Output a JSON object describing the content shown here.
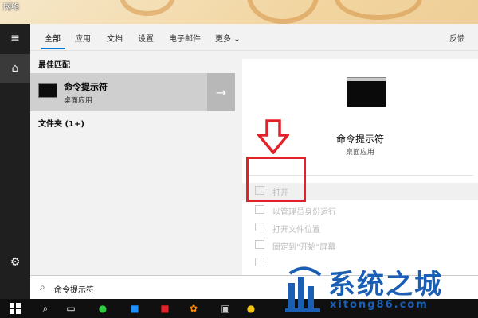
{
  "desktop": {
    "icon_label": "网络"
  },
  "tabs": [
    {
      "label": "全部"
    },
    {
      "label": "应用"
    },
    {
      "label": "文档"
    },
    {
      "label": "设置"
    },
    {
      "label": "电子邮件"
    },
    {
      "label": "更多"
    }
  ],
  "feedback_label": "反馈",
  "left": {
    "best_match_title": "最佳匹配",
    "best_match": {
      "name": "命令提示符",
      "subtitle": "桌面应用"
    },
    "folders_title": "文件夹 (1+)"
  },
  "preview": {
    "name": "命令提示符",
    "subtitle": "桌面应用",
    "actions": [
      {
        "label": "打开",
        "icon": "open-icon"
      },
      {
        "label": "以管理员身份运行",
        "icon": "admin-icon"
      },
      {
        "label": "打开文件位置",
        "icon": "file-location-icon"
      },
      {
        "label": "固定到\"开始\"屏幕",
        "icon": "pin-start-icon"
      },
      {
        "label": "",
        "icon": "pin-taskbar-icon"
      }
    ]
  },
  "search": {
    "query": "命令提示符"
  },
  "watermark": {
    "title": "系统之城",
    "url": "xitong86.com"
  },
  "colors": {
    "accent": "#0078d7",
    "annotation": "#e2222a",
    "watermark": "#1a5fb4"
  }
}
